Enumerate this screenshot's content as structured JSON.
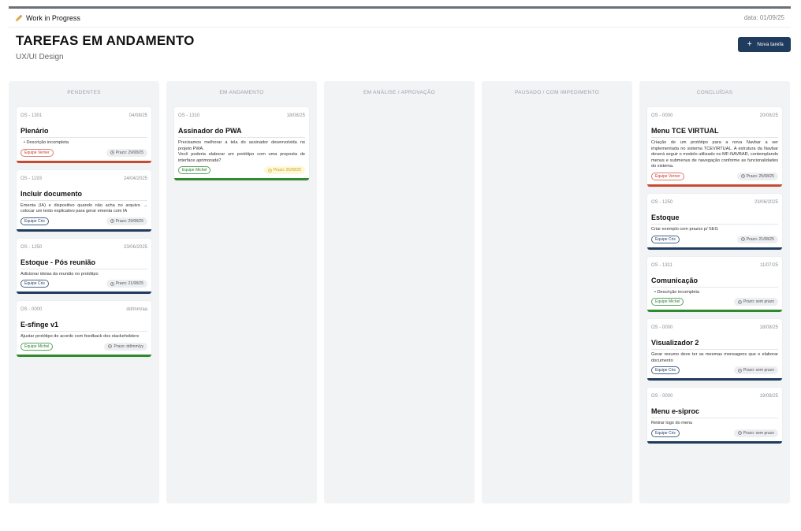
{
  "header": {
    "app_title": "Work in Progress",
    "date": "data: 01/09/25"
  },
  "page": {
    "title": "TAREFAS EM ANDAMENTO",
    "subtitle": "UX/UI Design",
    "new_task_label": "Nova tarefa"
  },
  "colors": {
    "accent": "#1f3b5d",
    "red": "#c84a33",
    "blue": "#1f3b5d",
    "green": "#2e8b2e"
  },
  "columns": [
    {
      "title": "PENDENTES",
      "cards": [
        {
          "os": "OS - 1301",
          "date": "04/08/25",
          "name": "Plenário",
          "desc": "Descrição incompleta",
          "bullet": true,
          "team": "Equipe Verner",
          "color": "red",
          "deadline": "Prazo: 29/08/25",
          "deadline_style": ""
        },
        {
          "os": "OS - 1193",
          "date": "24/04/2025",
          "name": "Incluir documento",
          "desc": "Ementa (IA) e dispositivo quando não acha no arquivo → colocar um texto explicativo para gerar ementa com IA",
          "bullet": false,
          "team": "Equipe Cris",
          "color": "blue",
          "deadline": "Prazo: 29/08/25",
          "deadline_style": ""
        },
        {
          "os": "OS - 1250",
          "date": "23/06/2025",
          "name": "Estoque - Pós reunião",
          "desc": "Adicionar ideias da reunião no protótipo",
          "bullet": false,
          "team": "Equipe Cris",
          "color": "blue",
          "deadline": "Prazo: 21/08/25",
          "deadline_style": ""
        },
        {
          "os": "OS - 0000",
          "date": "dd/mm/aa",
          "name": "E-sfinge v1",
          "desc": "Ajustar protótipo de acordo com feedback dos stackeholders",
          "bullet": false,
          "team": "Equipe Michel",
          "color": "green",
          "deadline": "Prazo: dd/mm/yy",
          "deadline_style": ""
        }
      ]
    },
    {
      "title": "EM ANDAMENTO",
      "cards": [
        {
          "os": "OS - 1310",
          "date": "18/08/25",
          "name": "Assinador do PWA",
          "desc": "Precisamos melhorar a tela do assinador desenvolvida no projeto PWA.\nVocê poderia elaborar um protótipo com uma proposta de interface aprimorada?",
          "bullet": false,
          "team": "Equipe Michel",
          "color": "green",
          "deadline": "Prazo: 25/08/25",
          "deadline_style": "yellow"
        }
      ]
    },
    {
      "title": "EM ANÁLISE / APROVAÇÃO",
      "cards": []
    },
    {
      "title": "PAUSADO / COM IMPEDIMENTO",
      "cards": []
    },
    {
      "title": "CONCLUÍDAS",
      "cards": [
        {
          "os": "OS - 0000",
          "date": "20/08/25",
          "name": "Menu TCE VIRTUAL",
          "desc": "Criação de um protótipo para a nova Navbar a ser implementada no sistema TCEVIRTUAL. A estrutura da Navbar deverá seguir o modelo utilizado no MF-NAVBAR, contemplando menus e submenus de navegação conforme as funcionalidades do sistema.",
          "bullet": false,
          "team": "Equipe Verner",
          "color": "red",
          "deadline": "Prazo: 25/08/25",
          "deadline_style": ""
        },
        {
          "os": "OS - 1250",
          "date": "23/06/2025",
          "name": "Estoque",
          "desc": "Criar exemplo com prazos p/ SEG",
          "bullet": false,
          "team": "Equipe Cris",
          "color": "blue",
          "deadline": "Prazo: 21/08/25",
          "deadline_style": ""
        },
        {
          "os": "OS - 1311",
          "date": "11/07/25",
          "name": "Comunicação",
          "desc": "Descrição incompleta",
          "bullet": true,
          "team": "Equipe Michel",
          "color": "green",
          "deadline": "Prazo: sem prazo",
          "deadline_style": ""
        },
        {
          "os": "OS - 0000",
          "date": "18/08/25",
          "name": "Visualizador 2",
          "desc": "Gerar resumo deve ter as mesmas mensagens que o elaborar documento",
          "bullet": false,
          "team": "Equipe Cris",
          "color": "blue",
          "deadline": "Prazo: sem prazo",
          "deadline_style": ""
        },
        {
          "os": "OS - 0000",
          "date": "19/08/25",
          "name": "Menu e-siproc",
          "desc": "Retirar logo do menu",
          "bullet": false,
          "team": "Equipe Cris",
          "color": "blue",
          "deadline": "Prazo: sem prazo",
          "deadline_style": ""
        }
      ]
    }
  ]
}
